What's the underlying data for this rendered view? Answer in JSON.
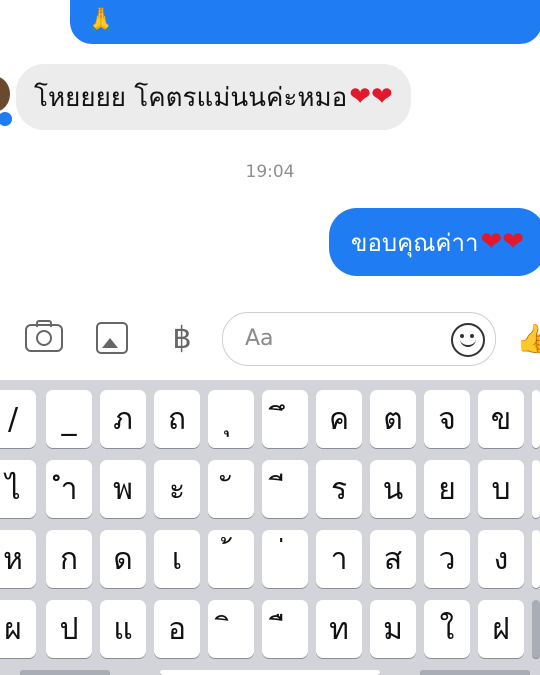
{
  "chat": {
    "top_bubble_emoji": "🙏",
    "incoming_text": "โหยยยย โคตรแม่นนค่ะหมอ",
    "incoming_hearts": "❤❤",
    "timestamp": "19:04",
    "outgoing_text": "ขอบคุณค่าา",
    "outgoing_hearts": "❤❤"
  },
  "composer": {
    "placeholder": "Aa",
    "baht_symbol": "฿",
    "thumb_symbol": "👍"
  },
  "keyboard": {
    "rows": [
      [
        "/",
        "_",
        "ภ",
        "ถ",
        "ุ",
        "ึ",
        "ค",
        "ต",
        "จ",
        "ข",
        ""
      ],
      [
        "ไ",
        "ำ",
        "พ",
        "ะ",
        "ั",
        "ี",
        "ร",
        "น",
        "ย",
        "บ",
        ""
      ],
      [
        "ห",
        "ก",
        "ด",
        "เ",
        "้",
        "่",
        "า",
        "ส",
        "ว",
        "ง",
        ""
      ],
      [
        "ผ",
        "ป",
        "แ",
        "อ",
        "ิ",
        "ื",
        "ท",
        "ม",
        "ใ",
        "ฝ",
        ""
      ]
    ]
  },
  "colors": {
    "accent": "#1f7cf2",
    "incoming_bg": "#ececec",
    "heart": "#e0192c",
    "keyboard_bg": "#d2d4da"
  }
}
